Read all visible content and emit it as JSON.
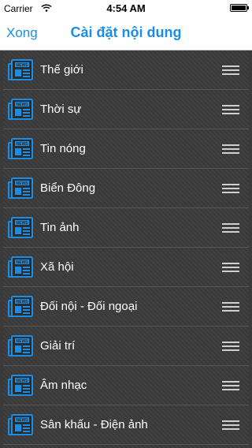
{
  "status_bar": {
    "carrier": "Carrier",
    "time": "4:54 AM"
  },
  "nav": {
    "back_label": "Xong",
    "title": "Cài đặt nội dung"
  },
  "icon": {
    "name": "news-icon",
    "text": "NEWS",
    "color": "#1a8ee6"
  },
  "items": [
    {
      "label": "Thế giới"
    },
    {
      "label": "Thời sự"
    },
    {
      "label": "Tin nóng"
    },
    {
      "label": "Biển Đông"
    },
    {
      "label": "Tin ảnh"
    },
    {
      "label": "Xã hội"
    },
    {
      "label": "Đối nội - Đối ngoại"
    },
    {
      "label": "Giải trí"
    },
    {
      "label": "Âm nhạc"
    },
    {
      "label": "Sân khấu -  Điện ảnh"
    }
  ]
}
